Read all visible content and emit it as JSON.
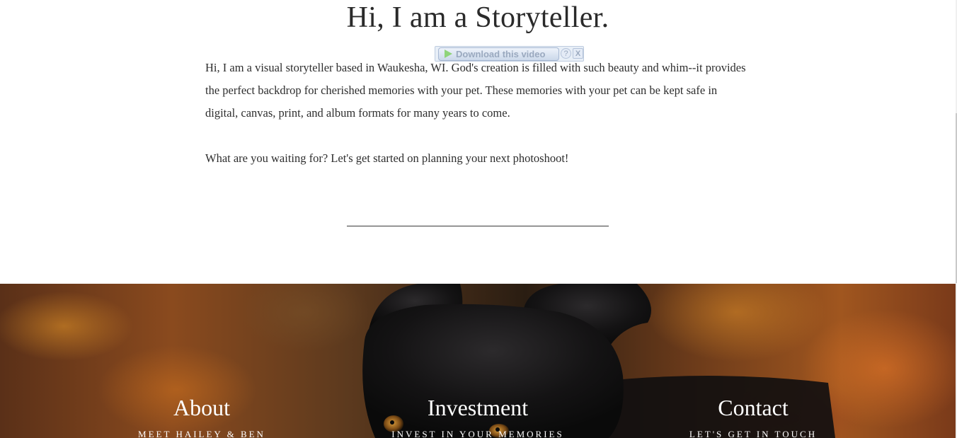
{
  "heading": "Hi, I am a Storyteller.",
  "intro": {
    "paragraph1": "Hi, I am a visual storyteller based in Waukesha, WI. God's creation is filled with such beauty and whim--it provides the perfect backdrop for cherished memories with your pet. These memories with your pet can be kept safe in digital, canvas, print, and album formats for many years to come.",
    "paragraph2": "What are you waiting for? Let's get started on planning your next photoshoot!"
  },
  "download_widget": {
    "label": "Download this video",
    "help": "?",
    "close": "X"
  },
  "footer_nav": [
    {
      "heading": "About",
      "sub": "MEET HAILEY & BEN"
    },
    {
      "heading": "Investment",
      "sub": "INVEST IN YOUR MEMORIES"
    },
    {
      "heading": "Contact",
      "sub": "LET'S GET IN TOUCH"
    }
  ],
  "colors": {
    "text": "#2b2b2b",
    "accent_autumn": "#a0561f",
    "overlay_text": "#ffffff"
  }
}
